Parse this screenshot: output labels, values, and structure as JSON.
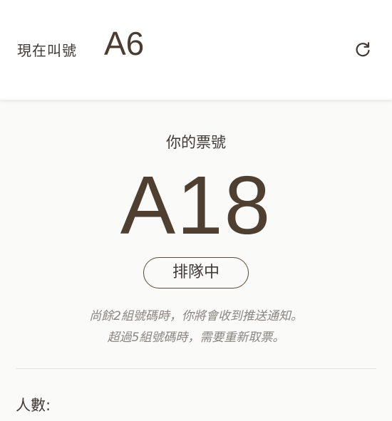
{
  "header": {
    "now_calling_label": "現在叫號",
    "now_calling_number": "A6",
    "refresh_icon": "refresh-icon"
  },
  "ticket": {
    "label": "你的票號",
    "number": "A18",
    "status": "排隊中"
  },
  "notice": {
    "line1": "尚餘2組號碼時，你將會收到推送通知。",
    "line2": "超過5組號碼時，需要重新取票。"
  },
  "form": {
    "people_label": "人數:"
  },
  "colors": {
    "primary_text": "#4a3c30",
    "muted_text": "#8a8580",
    "background": "#fafaf8"
  }
}
